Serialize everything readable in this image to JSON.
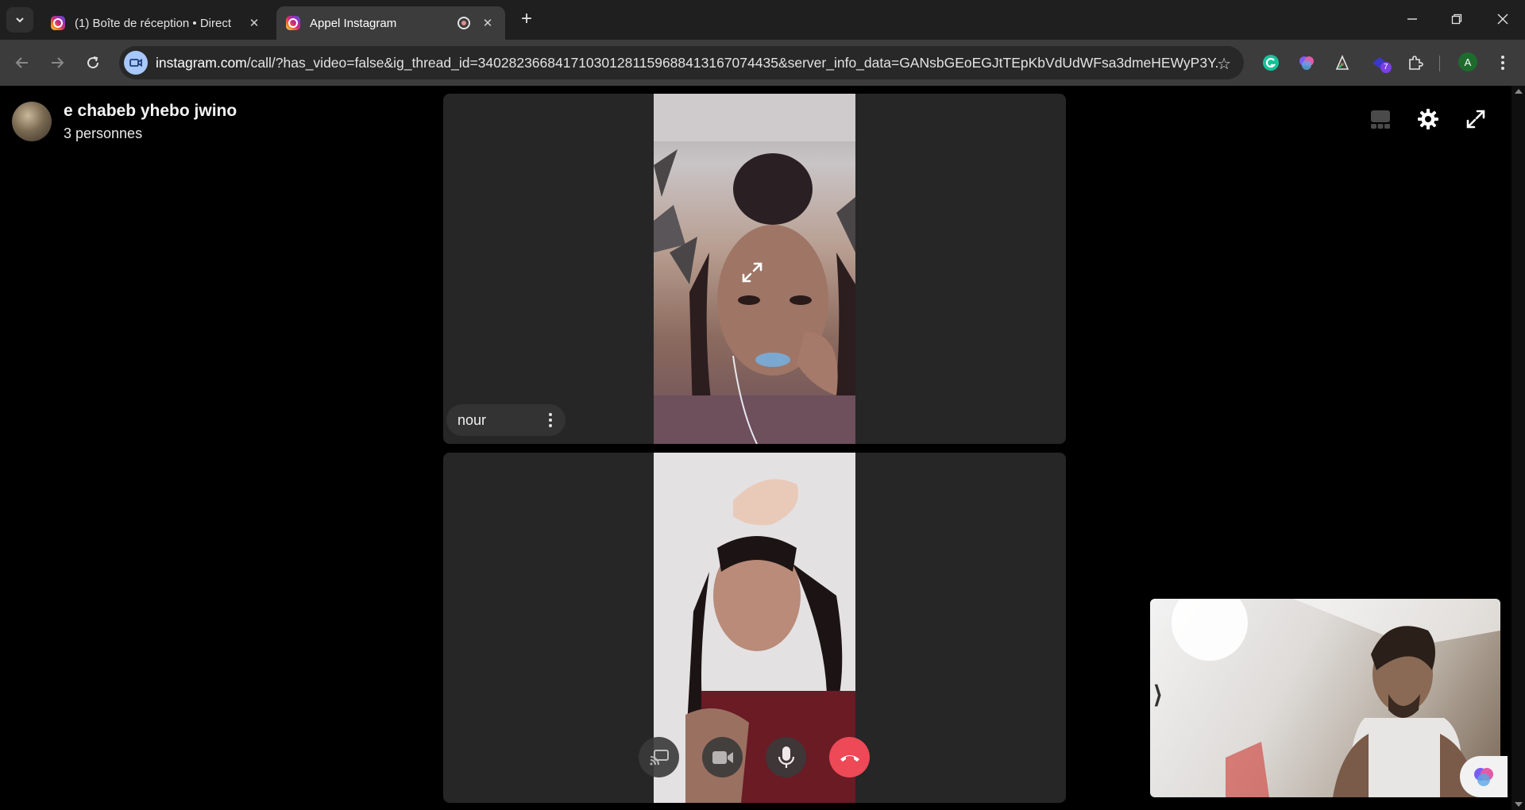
{
  "browser": {
    "tabs": [
      {
        "title": "(1) Boîte de réception • Direct",
        "favicon": "instagram-icon",
        "active": false
      },
      {
        "title": "Appel Instagram",
        "favicon": "instagram-icon",
        "active": true,
        "recording": true
      }
    ],
    "url_host": "instagram.com",
    "url_rest": "/call/?has_video=false&ig_thread_id=340282366841710301281159688413167074435&server_info_data=GANsbGEoEGJtTEpKbVdUdWFsa3dmeHEWyP3Y...",
    "extension_badge": "7",
    "profile_initial": "A"
  },
  "call": {
    "room_name": "e chabeb yhebo jwino",
    "participants_count": "3 personnes",
    "tiles": [
      {
        "name": "nour",
        "show_name": true
      },
      {
        "name": "",
        "show_name": false
      }
    ]
  },
  "colors": {
    "background": "#000000",
    "tile": "#262626",
    "end_call": "#ed4956",
    "chrome_tabstrip": "#1f1f1f",
    "chrome_toolbar": "#3c3c3c"
  }
}
